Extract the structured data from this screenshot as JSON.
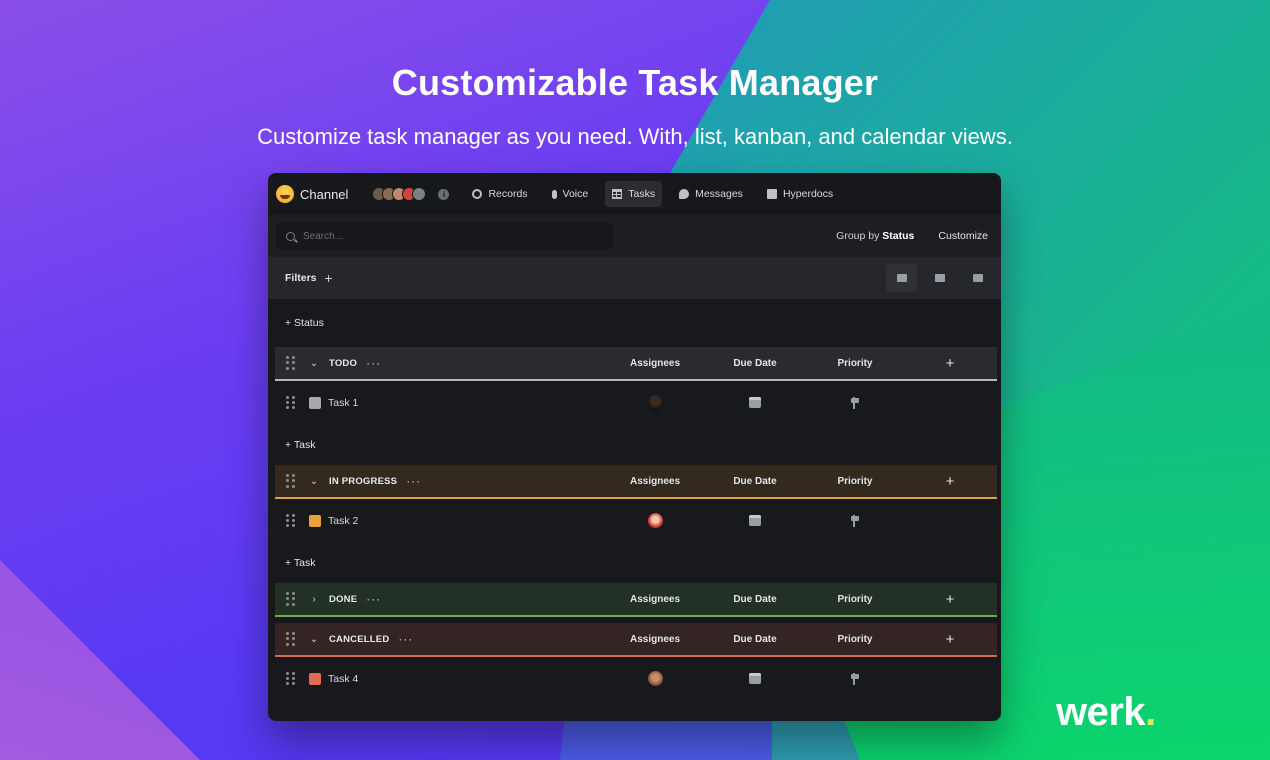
{
  "hero": {
    "title": "Customizable Task Manager",
    "subtitle": "Customize task manager as you need. With, list, kanban, and calendar views."
  },
  "brand": {
    "name": "werk",
    "dot": ".",
    "dot_color": "#d7f25f"
  },
  "topbar": {
    "channel": "Channel",
    "tabs": [
      {
        "label": "Records",
        "icon": "record-icon"
      },
      {
        "label": "Voice",
        "icon": "microphone-icon"
      },
      {
        "label": "Tasks",
        "icon": "table-icon",
        "active": true
      },
      {
        "label": "Messages",
        "icon": "chat-bubble-icon"
      },
      {
        "label": "Hyperdocs",
        "icon": "document-icon"
      }
    ]
  },
  "toolbar": {
    "search_placeholder": "Search...",
    "group_by_label": "Group by",
    "group_by_value": "Status",
    "customize": "Customize",
    "filters": "Filters",
    "add": "+",
    "views": [
      "list-view-icon",
      "table-view-icon",
      "calendar-view-icon"
    ]
  },
  "list": {
    "add_status": "+ Status",
    "add_task": "+ Task",
    "columns": {
      "assignees": "Assignees",
      "due_date": "Due Date",
      "priority": "Priority",
      "add": "+"
    },
    "groups": [
      {
        "name": "TODO",
        "color": "#b8b9bd",
        "bg": "#2a2b30",
        "expanded": true,
        "tasks": [
          {
            "name": "Task 1",
            "swatch": "#a7a8ad"
          }
        ]
      },
      {
        "name": "IN PROGRESS",
        "color": "#e0a04a",
        "bg": "#33291f",
        "expanded": true,
        "tasks": [
          {
            "name": "Task 2",
            "swatch": "#e9a23b"
          }
        ]
      },
      {
        "name": "DONE",
        "color": "#63b14a",
        "bg": "#223025",
        "expanded": false,
        "tasks": []
      },
      {
        "name": "CANCELLED",
        "color": "#d8694f",
        "bg": "#342524",
        "expanded": true,
        "tasks": [
          {
            "name": "Task 4",
            "swatch": "#e36a55"
          }
        ]
      }
    ]
  }
}
